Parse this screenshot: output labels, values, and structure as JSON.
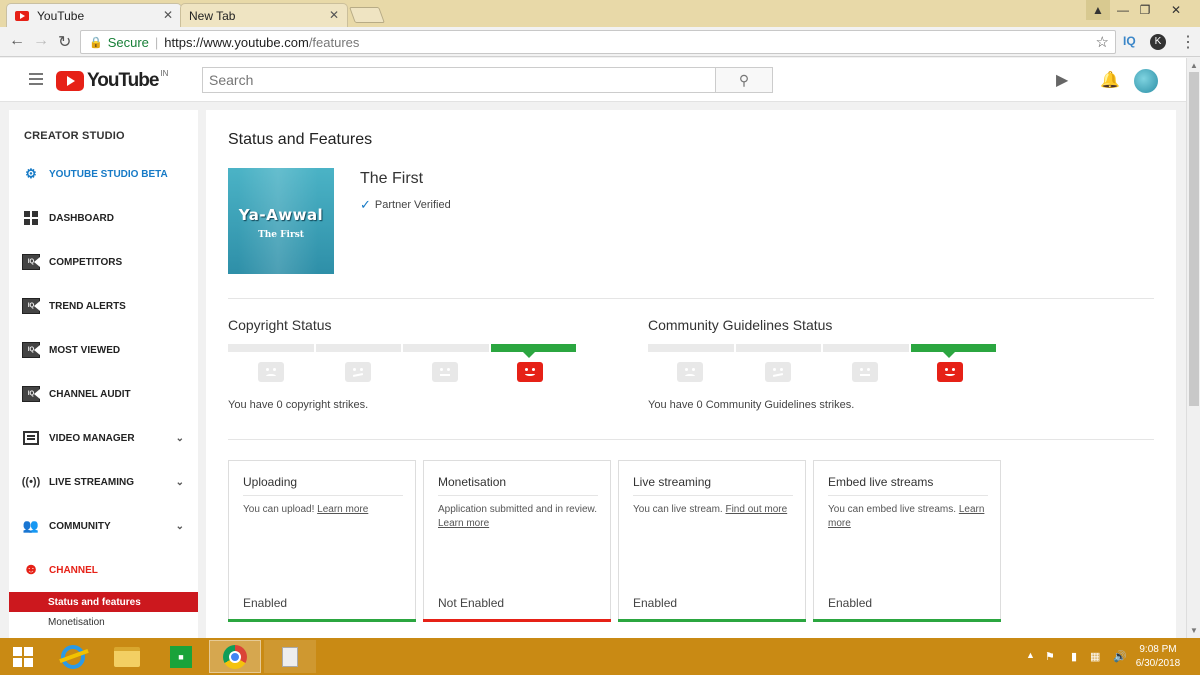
{
  "browser": {
    "tabs": [
      {
        "label": "YouTube",
        "active": true
      },
      {
        "label": "New Tab",
        "active": false
      }
    ],
    "tab_close": "✕",
    "secure_label": "Secure",
    "url_host": "https://www.youtube.com",
    "url_path": "/features",
    "ext_iq": "IQ",
    "ext_k": "K"
  },
  "header": {
    "logo_text": "YouTube",
    "country": "IN",
    "search_placeholder": "Search"
  },
  "sidebar": {
    "title": "CREATOR STUDIO",
    "items": [
      {
        "label": "YOUTUBE STUDIO BETA",
        "icon": "gear-icon"
      },
      {
        "label": "DASHBOARD",
        "icon": "dashboard-icon"
      },
      {
        "label": "COMPETITORS",
        "icon": "iq-icon"
      },
      {
        "label": "TREND ALERTS",
        "icon": "iq-icon"
      },
      {
        "label": "MOST VIEWED",
        "icon": "iq-icon"
      },
      {
        "label": "CHANNEL AUDIT",
        "icon": "iq-icon"
      },
      {
        "label": "VIDEO MANAGER",
        "icon": "video-manager-icon"
      },
      {
        "label": "LIVE STREAMING",
        "icon": "live-icon"
      },
      {
        "label": "COMMUNITY",
        "icon": "people-icon"
      },
      {
        "label": "CHANNEL",
        "icon": "account-icon"
      }
    ],
    "sub_items": [
      {
        "label": "Status and features",
        "active": true
      },
      {
        "label": "Monetisation",
        "active": false
      }
    ]
  },
  "main": {
    "page_title": "Status and Features",
    "thumb_line1": "Ya-Awwal",
    "thumb_line2": "The First",
    "channel_name": "The First",
    "partner_status": "Partner Verified",
    "copyright": {
      "title": "Copyright Status",
      "text": "You have 0 copyright strikes.",
      "active_level": 4
    },
    "community": {
      "title": "Community Guidelines Status",
      "text": "You have 0 Community Guidelines strikes.",
      "active_level": 4
    },
    "cards": [
      {
        "title": "Uploading",
        "desc": "You can upload!",
        "link": "Learn more",
        "status": "Enabled",
        "status_color": "#2ba640"
      },
      {
        "title": "Monetisation",
        "desc": "Application submitted and in review.",
        "link": "Learn more",
        "status": "Not Enabled",
        "status_color": "#e62117"
      },
      {
        "title": "Live streaming",
        "desc": "You can live stream.",
        "link": "Find out more",
        "status": "Enabled",
        "status_color": "#2ba640"
      },
      {
        "title": "Embed live streams",
        "desc": "You can embed live streams.",
        "link": "Learn more",
        "status": "Enabled",
        "status_color": "#2ba640"
      }
    ]
  },
  "taskbar": {
    "time": "9:08 PM",
    "date": "6/30/2018"
  },
  "colors": {
    "accent_red": "#e62117",
    "accent_blue": "#167ac6",
    "status_green": "#2ba640"
  }
}
